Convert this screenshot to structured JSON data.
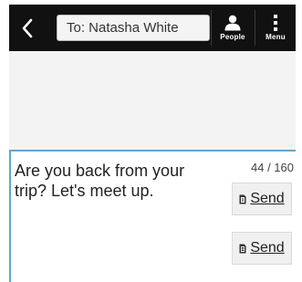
{
  "header": {
    "recipient_text": "To: Natasha White",
    "people_label": "People",
    "menu_label": "Menu"
  },
  "icons": {
    "back": "chevron-left-icon",
    "people": "person-icon",
    "menu": "vertical-dots-icon",
    "sim1": "sim-card-1-icon",
    "sim2": "sim-card-2-icon"
  },
  "compose": {
    "message": "Are you back from your trip? Let's meet up.",
    "char_count": "44 / 160",
    "send_label_1": "Send",
    "send_label_2": "Send"
  },
  "colors": {
    "action_bar": "#111111",
    "compose_accent": "#5fa8c9",
    "conversation_bg": "#f3f3f3"
  }
}
